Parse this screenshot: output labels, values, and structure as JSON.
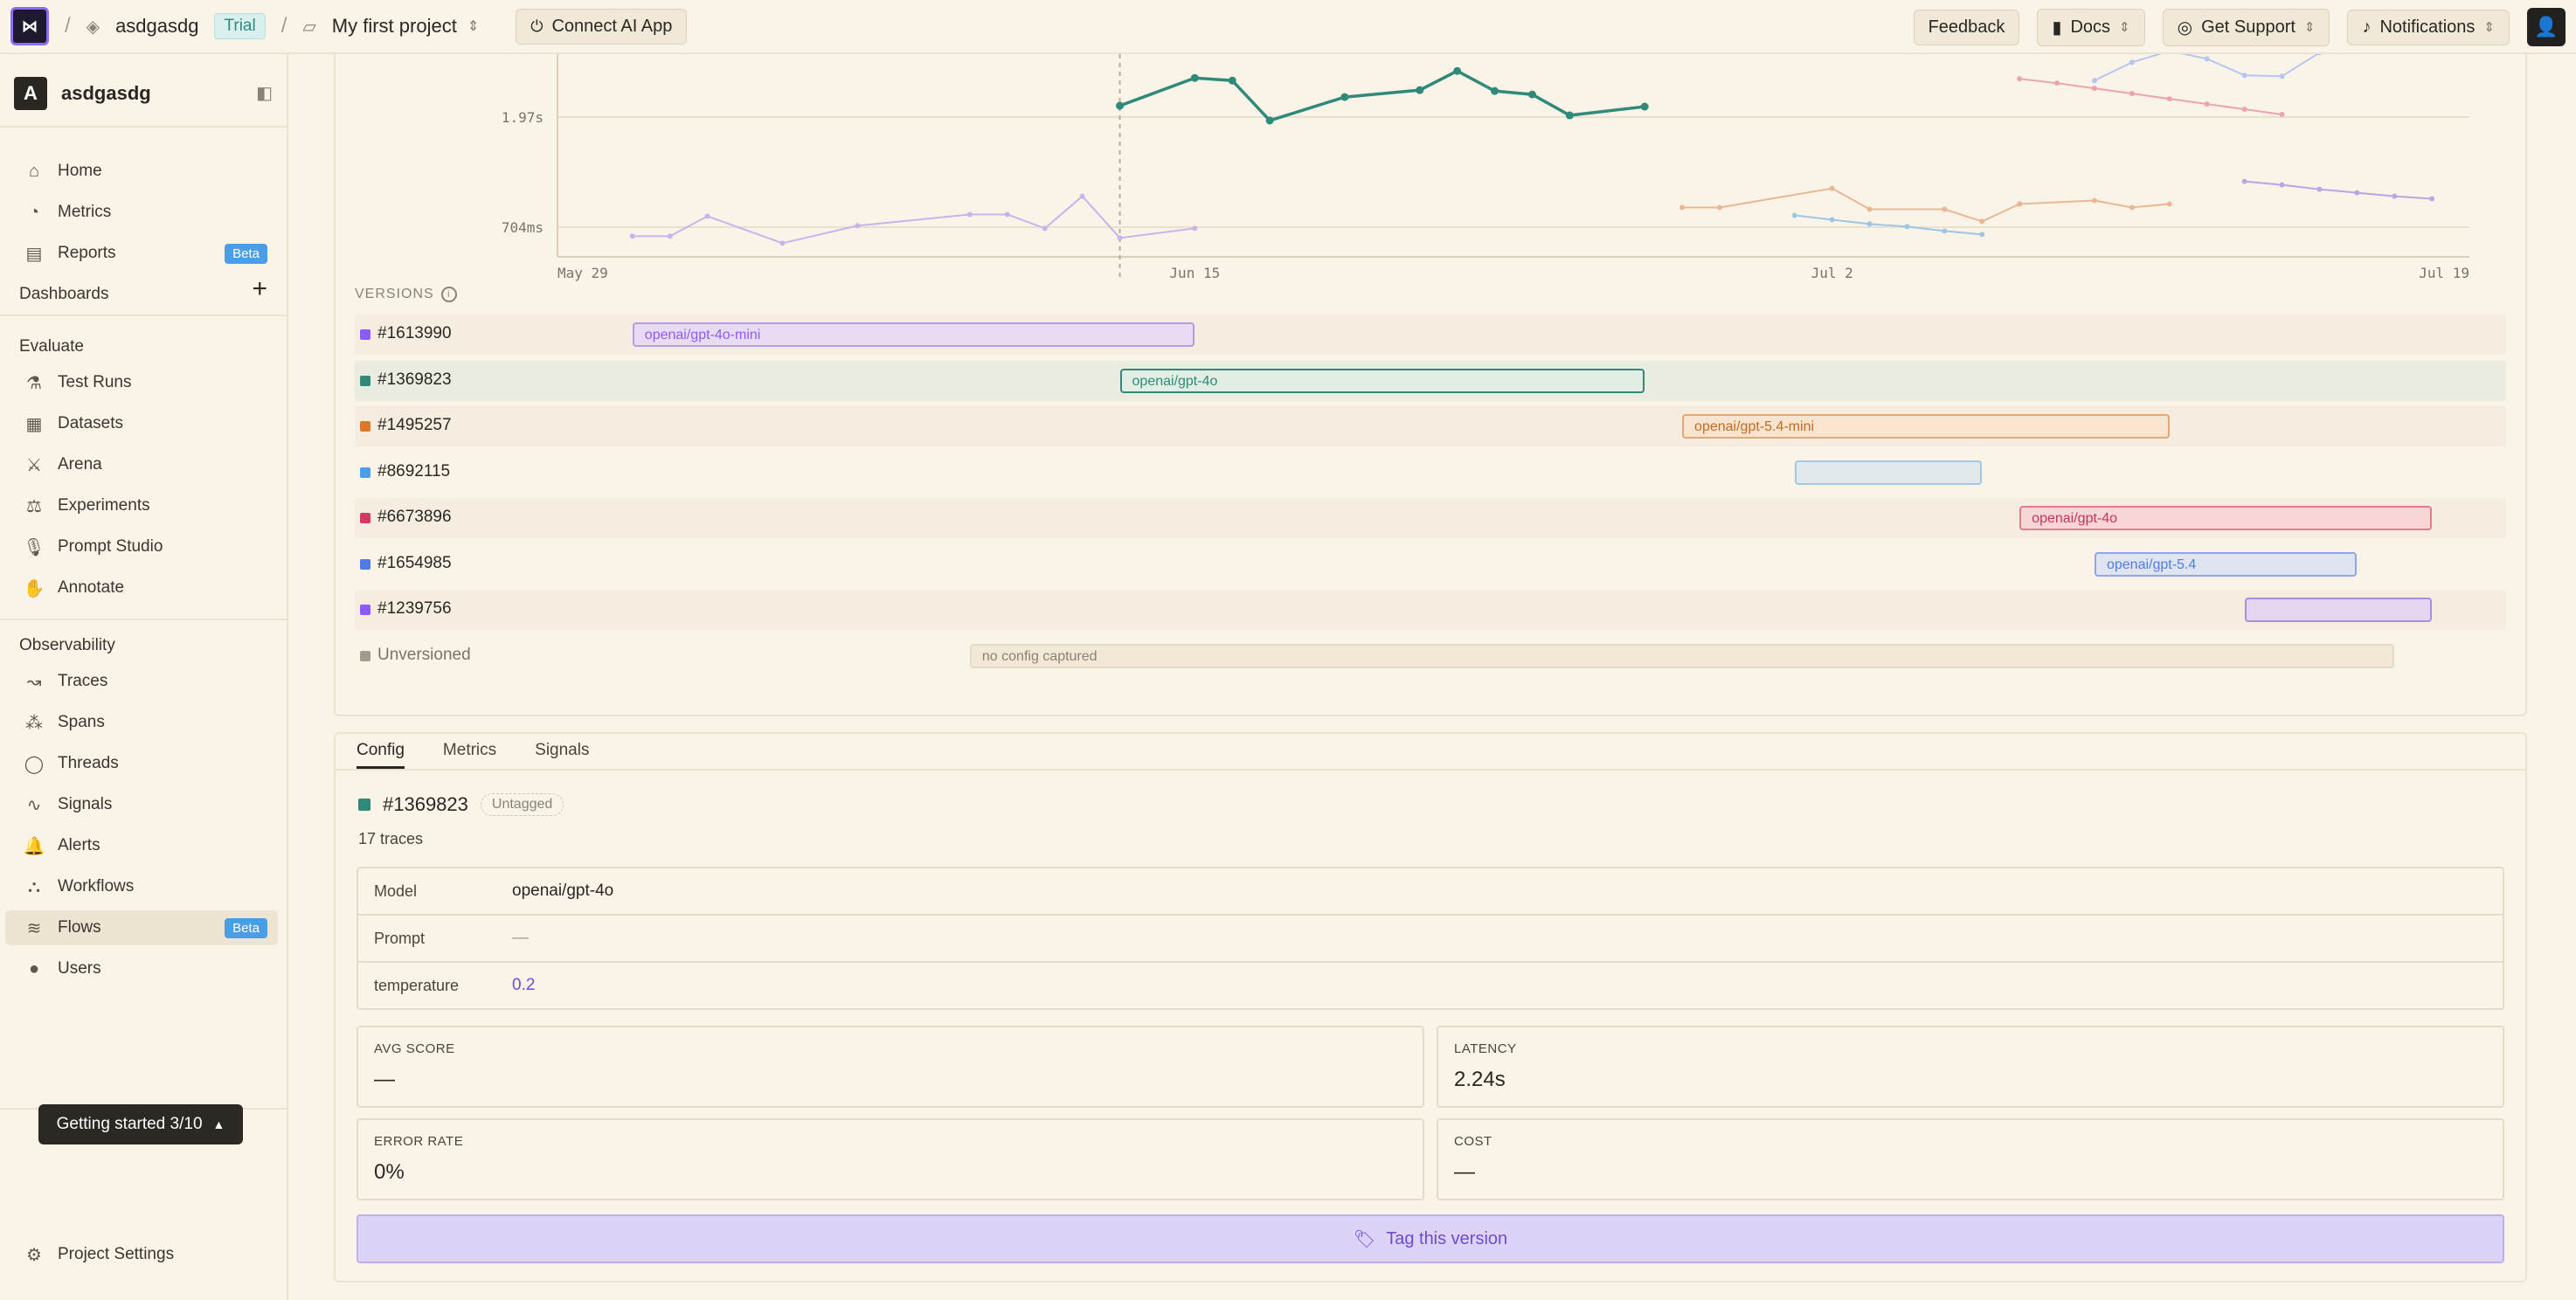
{
  "topbar": {
    "workspace": "asdgasdg",
    "trial": "Trial",
    "project": "My first project",
    "connect": "Connect AI App",
    "feedback": "Feedback",
    "docs": "Docs",
    "support": "Get Support",
    "notifications": "Notifications"
  },
  "sidebar": {
    "workspace_initial": "A",
    "workspace_name": "asdgasdg",
    "main_items": [
      {
        "label": "Home",
        "icon": "home-icon"
      },
      {
        "label": "Metrics",
        "icon": "gauge-icon"
      },
      {
        "label": "Reports",
        "icon": "document-icon",
        "badge": "Beta"
      }
    ],
    "dashboards": "Dashboards",
    "evaluate_label": "Evaluate",
    "evaluate_items": [
      {
        "label": "Test Runs",
        "icon": "flask-icon"
      },
      {
        "label": "Datasets",
        "icon": "file-icon"
      },
      {
        "label": "Arena",
        "icon": "swords-icon"
      },
      {
        "label": "Experiments",
        "icon": "scale-icon"
      },
      {
        "label": "Prompt Studio",
        "icon": "mic-icon"
      },
      {
        "label": "Annotate",
        "icon": "hand-icon"
      }
    ],
    "observability_label": "Observability",
    "observability_items": [
      {
        "label": "Traces",
        "icon": "route-icon"
      },
      {
        "label": "Spans",
        "icon": "cluster-icon"
      },
      {
        "label": "Threads",
        "icon": "chat-icon"
      },
      {
        "label": "Signals",
        "icon": "pulse-icon"
      },
      {
        "label": "Alerts",
        "icon": "bell-icon"
      },
      {
        "label": "Workflows",
        "icon": "workflow-icon"
      },
      {
        "label": "Flows",
        "icon": "waves-icon",
        "badge": "Beta"
      },
      {
        "label": "Users",
        "icon": "user-icon"
      }
    ],
    "getting_started": "Getting started 3/10",
    "project_settings": "Project Settings"
  },
  "chart_data": {
    "type": "line",
    "y_ticks": [
      "1.97s",
      "704ms"
    ],
    "x_ticks": [
      "May 29",
      "Jun 15",
      "Jul 2",
      "Jul 19"
    ],
    "series": [
      {
        "name": "#1613990",
        "color": "#c9b3ec",
        "points": [
          [
            2,
            0.6
          ],
          [
            3,
            0.6
          ],
          [
            4,
            0.83
          ],
          [
            6,
            0.52
          ],
          [
            8,
            0.72
          ],
          [
            11,
            0.85
          ],
          [
            12,
            0.85
          ],
          [
            13,
            0.69
          ],
          [
            14,
            1.06
          ],
          [
            15,
            0.58
          ],
          [
            17,
            0.69
          ]
        ]
      },
      {
        "name": "#1369823",
        "color": "#2f8a7a",
        "points": [
          [
            15,
            2.1
          ],
          [
            17,
            2.42
          ],
          [
            18,
            2.39
          ],
          [
            19,
            1.93
          ],
          [
            21,
            2.2
          ],
          [
            23,
            2.28
          ],
          [
            24,
            2.5
          ],
          [
            25,
            2.27
          ],
          [
            26,
            2.23
          ],
          [
            27,
            1.99
          ],
          [
            29,
            2.09
          ]
        ]
      },
      {
        "name": "#1495257",
        "color": "#eab792",
        "points": [
          [
            30,
            0.93
          ],
          [
            31,
            0.93
          ],
          [
            34,
            1.15
          ],
          [
            35,
            0.91
          ],
          [
            37,
            0.91
          ],
          [
            38,
            0.77
          ],
          [
            39,
            0.97
          ],
          [
            41,
            1.01
          ],
          [
            42,
            0.93
          ],
          [
            43,
            0.97
          ]
        ]
      },
      {
        "name": "#8692115",
        "color": "#9cc6e6",
        "points": [
          [
            33,
            0.84
          ],
          [
            34,
            0.79
          ],
          [
            35,
            0.74
          ],
          [
            36,
            0.71
          ],
          [
            37,
            0.66
          ],
          [
            38,
            0.62
          ]
        ]
      },
      {
        "name": "#6673896",
        "color": "#eda3ae",
        "points": [
          [
            39,
            2.41
          ],
          [
            40,
            2.36
          ],
          [
            41,
            2.3
          ],
          [
            42,
            2.24
          ],
          [
            43,
            2.18
          ],
          [
            44,
            2.12
          ],
          [
            45,
            2.06
          ],
          [
            46,
            2.0
          ]
        ]
      },
      {
        "name": "#1654985",
        "color": "#b6c6f0",
        "points": [
          [
            41,
            2.39
          ],
          [
            42,
            2.6
          ],
          [
            43,
            2.73
          ],
          [
            44,
            2.64
          ],
          [
            45,
            2.45
          ],
          [
            46,
            2.44
          ],
          [
            47,
            2.71
          ]
        ]
      },
      {
        "name": "#1239756",
        "color": "#b9a6e6",
        "points": [
          [
            45,
            1.23
          ],
          [
            46,
            1.19
          ],
          [
            47,
            1.14
          ],
          [
            48,
            1.1
          ],
          [
            49,
            1.06
          ],
          [
            50,
            1.03
          ]
        ]
      }
    ],
    "hover_x": 15
  },
  "versions": {
    "label": "VERSIONS",
    "rows": [
      {
        "id": "#1613990",
        "color": "#8b5cf6",
        "bar_label": "openai/gpt-4o-mini",
        "start": 2,
        "end": 17,
        "bar_bg": "#e9dbf3",
        "bar_border": "#b99be5",
        "text_color": "#8b5cf6"
      },
      {
        "id": "#1369823",
        "color": "#2f8a7a",
        "bar_label": "openai/gpt-4o",
        "start": 15,
        "end": 29,
        "bar_bg": "#e1eee4",
        "bar_border": "#2f8a7a",
        "text_color": "#2f8a7a"
      },
      {
        "id": "#1495257",
        "color": "#d97a2b",
        "bar_label": "openai/gpt-5.4-mini",
        "start": 30,
        "end": 43,
        "bar_bg": "#f8e4cf",
        "bar_border": "#e4a674",
        "text_color": "#c46a22"
      },
      {
        "id": "#8692115",
        "color": "#4b9ee6",
        "bar_label": "",
        "start": 33,
        "end": 38,
        "bar_bg": "#e1e9ec",
        "bar_border": "#a2c8e2",
        "text_color": "#4b9ee6"
      },
      {
        "id": "#6673896",
        "color": "#d63865",
        "bar_label": "openai/gpt-4o",
        "start": 39,
        "end": 50,
        "bar_bg": "#f7d7d6",
        "bar_border": "#e07c8e",
        "text_color": "#c9325c"
      },
      {
        "id": "#1654985",
        "color": "#4f7ce6",
        "bar_label": "openai/gpt-5.4",
        "start": 41,
        "end": 48,
        "bar_bg": "#e0e4f1",
        "bar_border": "#8ea7ea",
        "text_color": "#4f7ce6"
      },
      {
        "id": "#1239756",
        "color": "#8b5cf6",
        "bar_label": "",
        "start": 45,
        "end": 50,
        "bar_bg": "#e4d6ef",
        "bar_border": "#a88ce6",
        "text_color": "#8b5cf6"
      },
      {
        "id": "Unversioned",
        "color": "#a39a8a",
        "bar_label": "no config captured",
        "start": 11,
        "end": 49,
        "bar_bg": "#f1e9d6",
        "bar_border": "#e4dbc5",
        "text_color": "#8a8276"
      }
    ]
  },
  "detail": {
    "tabs": [
      "Config",
      "Metrics",
      "Signals"
    ],
    "version_id": "#1369823",
    "untagged": "Untagged",
    "traces": "17 traces",
    "config": [
      {
        "key": "Model",
        "value": "openai/gpt-4o"
      },
      {
        "key": "Prompt",
        "value": "—"
      },
      {
        "key": "temperature",
        "value": "0.2"
      }
    ],
    "stats": [
      {
        "label": "AVG SCORE",
        "value": "—"
      },
      {
        "label": "LATENCY",
        "value": "2.24s"
      },
      {
        "label": "ERROR RATE",
        "value": "0%"
      },
      {
        "label": "COST",
        "value": "—"
      }
    ],
    "tag_button": "Tag this version"
  }
}
